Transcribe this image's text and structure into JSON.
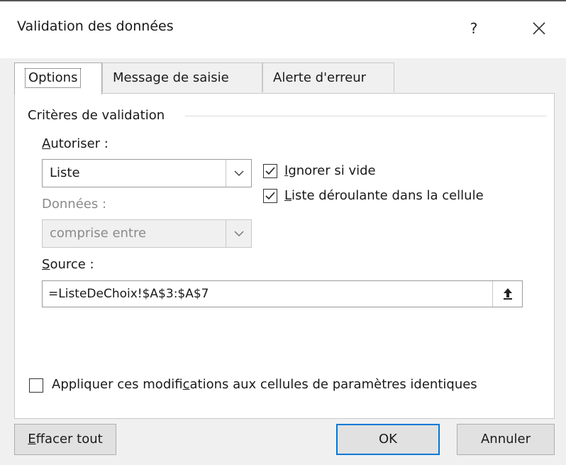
{
  "window": {
    "title": "Validation des données",
    "help_glyph": "?",
    "close_glyph": "✕"
  },
  "tabs": [
    {
      "label": "Options",
      "active": true
    },
    {
      "label": "Message de saisie",
      "active": false
    },
    {
      "label": "Alerte d'erreur",
      "active": false
    }
  ],
  "criteria": {
    "group_title": "Critères de validation",
    "allow_label": "Autoriser :",
    "allow_value": "Liste",
    "data_label": "Données :",
    "data_value": "comprise entre",
    "ignore_blank_label": "Ignorer si vide",
    "ignore_blank_checked": true,
    "in_cell_dropdown_label": "Liste déroulante dans la cellule",
    "in_cell_dropdown_checked": true,
    "source_label": "Source :",
    "source_value": "=ListeDeChoix!$A$3:$A$7"
  },
  "apply_all": {
    "label": "Appliquer ces modifications aux cellules de paramètres identiques",
    "checked": false
  },
  "buttons": {
    "clear_all": "Effacer tout",
    "ok": "OK",
    "cancel": "Annuler"
  },
  "colors": {
    "accent": "#0078d7",
    "dialog_bg": "#f0f0f0",
    "panel_bg": "#ffffff"
  }
}
